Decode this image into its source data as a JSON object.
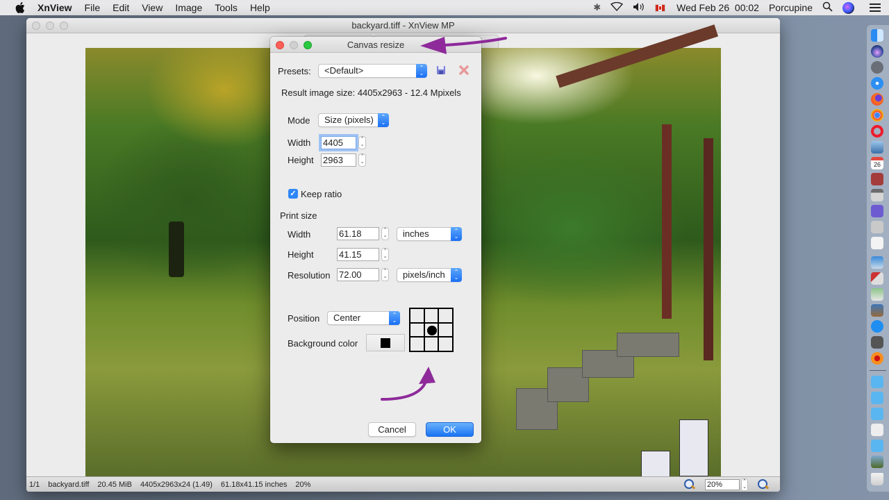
{
  "menubar": {
    "apple_icon": "apple-icon",
    "app_name": "XnView",
    "menus": [
      "File",
      "Edit",
      "View",
      "Image",
      "Tools",
      "Help"
    ],
    "status_icons": [
      "bluetooth-icon",
      "wifi-icon",
      "volume-icon",
      "canada-flag-icon"
    ],
    "clock": "Wed Feb 26  00:02",
    "user": "Porcupine",
    "search_icon": "spotlight-search-icon",
    "siri_icon": "siri-icon",
    "notification_icon": "notification-center-icon"
  },
  "main_window": {
    "title": "backyard.tiff - XnView MP",
    "statusbar": {
      "index": "1/1",
      "filename": "backyard.tiff",
      "filesize": "20.45 MiB",
      "dimensions": "4405x2963x24 (1.49)",
      "print_size": "61.18x41.15 inches",
      "zoom_text": "20%",
      "zoom_field": "20%"
    }
  },
  "dialog": {
    "title": "Canvas resize",
    "presets_label": "Presets:",
    "presets_value": "<Default>",
    "result_text": "Result image size: 4405x2963 - 12.4 Mpixels",
    "mode_label": "Mode",
    "mode_value": "Size (pixels)",
    "width_label": "Width",
    "width_value": "4405",
    "height_label": "Height",
    "height_value": "2963",
    "keep_ratio_label": "Keep ratio",
    "keep_ratio_checked": true,
    "print_size_label": "Print size",
    "print_width_label": "Width",
    "print_width_value": "61.18",
    "print_unit_value": "inches",
    "print_height_label": "Height",
    "print_height_value": "41.15",
    "resolution_label": "Resolution",
    "resolution_value": "72.00",
    "resolution_unit_value": "pixels/inch",
    "position_label": "Position",
    "position_value": "Center",
    "position_grid_selected": "center",
    "background_color_label": "Background color",
    "background_color": "#000000",
    "cancel_label": "Cancel",
    "ok_label": "OK"
  },
  "annotations": {
    "arrow_color": "#8e2a9a"
  },
  "dock": {
    "items": [
      "finder",
      "siri",
      "launchpad",
      "safari",
      "firefox",
      "chrome",
      "opera",
      "preview",
      "calendar",
      "dictionary",
      "calculator",
      "bbedit",
      "photo-slideshow",
      "textedit",
      "image-capture",
      "photo-booth",
      "photos-viewer",
      "image-browser",
      "app-store",
      "system-preferences",
      "xnview",
      "folder-applications",
      "folder-documents",
      "folder-downloads",
      "document-stack",
      "folder-pictures",
      "image-stack",
      "trash"
    ],
    "calendar_day": "26"
  },
  "colors": {
    "accent_blue": "#1a74f3",
    "close_red": "#fc5f57",
    "zoom_green": "#2bc840"
  }
}
